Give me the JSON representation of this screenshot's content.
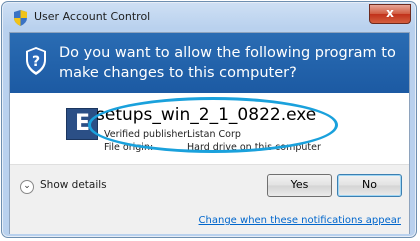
{
  "window": {
    "title": "User Account Control",
    "close_symbol": "x"
  },
  "prompt": {
    "question": "Do you want to allow the following program to make changes to this computer?"
  },
  "program": {
    "name": "setups_win_2_1_0822.exe",
    "icon_letter": "E",
    "publisher_label": "Verified publisher:",
    "publisher_value": "Listan Corp",
    "origin_label": "File origin:",
    "origin_value": "Hard drive on this computer"
  },
  "actions": {
    "show_details": "Show details",
    "yes": "Yes",
    "no": "No"
  },
  "footer": {
    "link": "Change when these notifications appear"
  },
  "colors": {
    "header_blue": "#1f5fa8",
    "highlight_ellipse": "#1aa1dc",
    "link": "#0066cc"
  }
}
